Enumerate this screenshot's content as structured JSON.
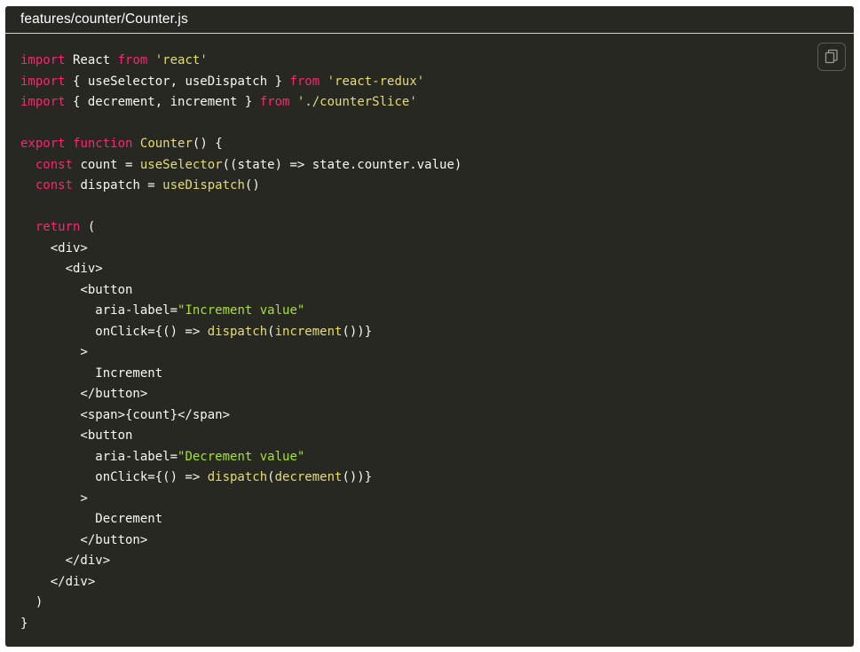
{
  "file": {
    "title": "features/counter/Counter.js"
  },
  "copy_button": {
    "icon": "copy-icon"
  },
  "colors": {
    "background": "#272822",
    "plain": "#f8f8f2",
    "keyword": "#f92672",
    "string": "#e6db74",
    "attr_string": "#a6e22e",
    "function": "#e6db74"
  },
  "code": {
    "lines": [
      [
        [
          "keyword",
          "import"
        ],
        [
          "plain",
          " React "
        ],
        [
          "keyword",
          "from"
        ],
        [
          "plain",
          " "
        ],
        [
          "string",
          "'react'"
        ]
      ],
      [
        [
          "keyword",
          "import"
        ],
        [
          "plain",
          " { useSelector, useDispatch } "
        ],
        [
          "keyword",
          "from"
        ],
        [
          "plain",
          " "
        ],
        [
          "string",
          "'react-redux'"
        ]
      ],
      [
        [
          "keyword",
          "import"
        ],
        [
          "plain",
          " { decrement, increment } "
        ],
        [
          "keyword",
          "from"
        ],
        [
          "plain",
          " "
        ],
        [
          "string",
          "'./counterSlice'"
        ]
      ],
      [],
      [
        [
          "keyword",
          "export"
        ],
        [
          "plain",
          " "
        ],
        [
          "keyword",
          "function"
        ],
        [
          "plain",
          " "
        ],
        [
          "func",
          "Counter"
        ],
        [
          "plain",
          "() {"
        ]
      ],
      [
        [
          "plain",
          "  "
        ],
        [
          "keyword",
          "const"
        ],
        [
          "plain",
          " count = "
        ],
        [
          "func",
          "useSelector"
        ],
        [
          "plain",
          "((state) => state.counter.value)"
        ]
      ],
      [
        [
          "plain",
          "  "
        ],
        [
          "keyword",
          "const"
        ],
        [
          "plain",
          " dispatch = "
        ],
        [
          "func",
          "useDispatch"
        ],
        [
          "plain",
          "()"
        ]
      ],
      [],
      [
        [
          "plain",
          "  "
        ],
        [
          "keyword",
          "return"
        ],
        [
          "plain",
          " ("
        ]
      ],
      [
        [
          "plain",
          "    <div>"
        ]
      ],
      [
        [
          "plain",
          "      <div>"
        ]
      ],
      [
        [
          "plain",
          "        <button"
        ]
      ],
      [
        [
          "plain",
          "          aria-label="
        ],
        [
          "attrstr",
          "\"Increment value\""
        ]
      ],
      [
        [
          "plain",
          "          onClick={() => "
        ],
        [
          "func",
          "dispatch"
        ],
        [
          "plain",
          "("
        ],
        [
          "func",
          "increment"
        ],
        [
          "plain",
          "())}"
        ]
      ],
      [
        [
          "plain",
          "        >"
        ]
      ],
      [
        [
          "plain",
          "          Increment"
        ]
      ],
      [
        [
          "plain",
          "        </button>"
        ]
      ],
      [
        [
          "plain",
          "        <span>{count}</span>"
        ]
      ],
      [
        [
          "plain",
          "        <button"
        ]
      ],
      [
        [
          "plain",
          "          aria-label="
        ],
        [
          "attrstr",
          "\"Decrement value\""
        ]
      ],
      [
        [
          "plain",
          "          onClick={() => "
        ],
        [
          "func",
          "dispatch"
        ],
        [
          "plain",
          "("
        ],
        [
          "func",
          "decrement"
        ],
        [
          "plain",
          "())}"
        ]
      ],
      [
        [
          "plain",
          "        >"
        ]
      ],
      [
        [
          "plain",
          "          Decrement"
        ]
      ],
      [
        [
          "plain",
          "        </button>"
        ]
      ],
      [
        [
          "plain",
          "      </div>"
        ]
      ],
      [
        [
          "plain",
          "    </div>"
        ]
      ],
      [
        [
          "plain",
          "  )"
        ]
      ],
      [
        [
          "plain",
          "}"
        ]
      ]
    ]
  }
}
